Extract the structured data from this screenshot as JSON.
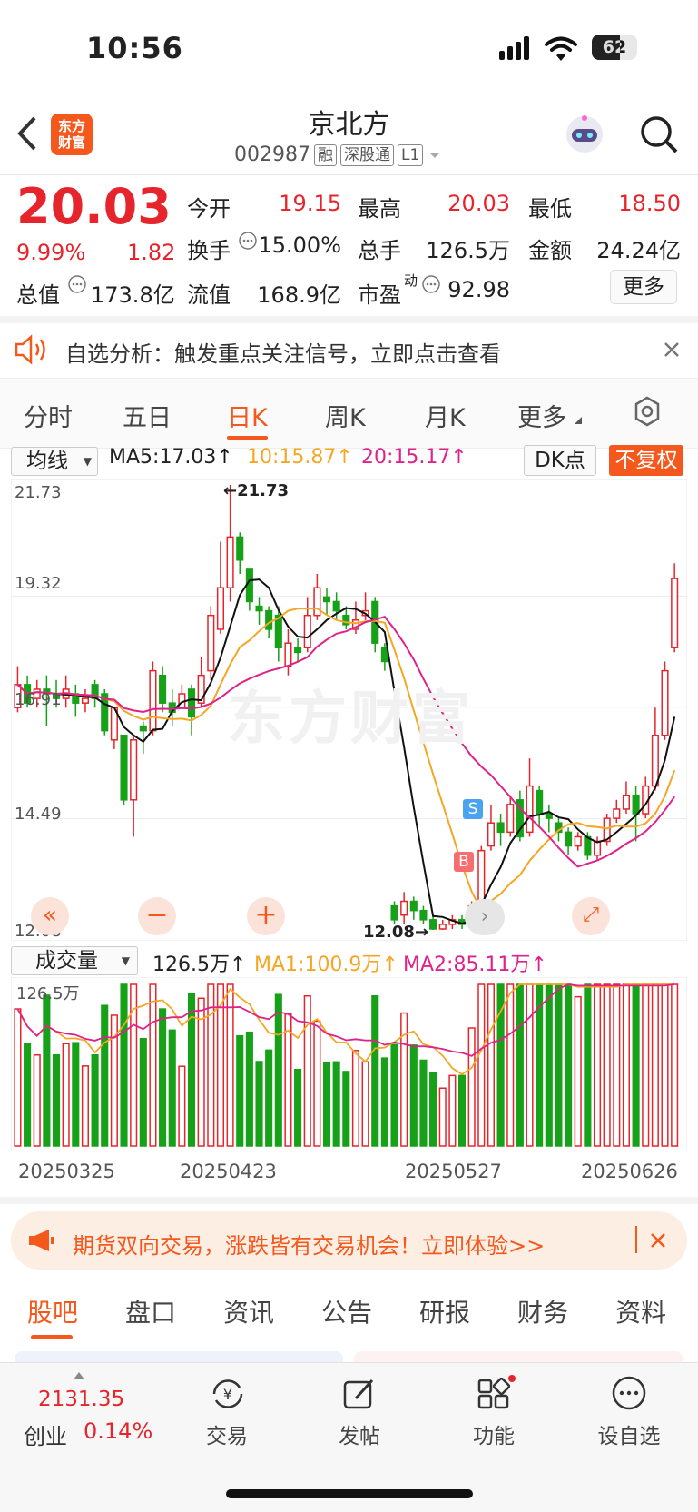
{
  "status": {
    "time": "10:56",
    "battery": "62"
  },
  "header": {
    "title": "京北方",
    "code": "002987",
    "tags": [
      "融",
      "深股通",
      "L1"
    ],
    "logo": "东方\n财富"
  },
  "quote": {
    "price": "20.03",
    "pct": "9.99%",
    "chg": "1.82",
    "fields": [
      {
        "label": "今开",
        "value": "19.15",
        "color": "red"
      },
      {
        "label": "最高",
        "value": "20.03",
        "color": "red"
      },
      {
        "label": "最低",
        "value": "18.50",
        "color": "red"
      },
      {
        "label": "换手",
        "value": "15.00%",
        "color": "dark"
      },
      {
        "label": "总手",
        "value": "126.5万",
        "color": "dark"
      },
      {
        "label": "金额",
        "value": "24.24亿",
        "color": "dark"
      },
      {
        "label": "总值",
        "value": "173.8亿",
        "color": "dark"
      },
      {
        "label": "流值",
        "value": "168.9亿",
        "color": "dark"
      },
      {
        "label": "市盈",
        "value": "92.98",
        "color": "dark",
        "sup": "动"
      }
    ],
    "more": "更多"
  },
  "alert": {
    "text": "自选分析：触发重点关注信号，立即点击查看"
  },
  "tabs": [
    "分时",
    "五日",
    "日K",
    "周K",
    "月K",
    "更多"
  ],
  "active_tab": "日K",
  "ma": {
    "selector": "均线",
    "ma5": "MA5:17.03",
    "ma10": "10:15.87",
    "ma20": "20:15.17",
    "dk": "DK点",
    "fq": "不复权"
  },
  "chart": {
    "y_ticks": [
      "21.73",
      "19.32",
      "16.91",
      "14.49",
      "12.08"
    ],
    "high_label": "21.73",
    "low_label": "12.08",
    "watermark": "东方财富",
    "b_mark": "B",
    "s_mark": "S"
  },
  "volume": {
    "selector": "成交量",
    "vol": "126.5万",
    "ma1": "MA1:100.9万",
    "ma2": "MA2:85.11万",
    "top_tick": "126.5万",
    "dates": [
      "20250325",
      "20250423",
      "20250527",
      "20250626"
    ]
  },
  "banner": {
    "text": "期货双向交易，涨跌皆有交易机会！立即体验>>"
  },
  "bottom_tabs": [
    "股吧",
    "盘口",
    "资讯",
    "公告",
    "研报",
    "财务",
    "资料"
  ],
  "bottom_bar": {
    "index_value": "2131.35",
    "index_name": "创业",
    "index_pct": "0.14%",
    "items": [
      "交易",
      "发帖",
      "功能",
      "设自选"
    ]
  },
  "colors": {
    "up": "#e5252b",
    "down": "#16a118",
    "accent": "#f4581c",
    "ma5": "#111111",
    "ma10": "#f5a623",
    "ma20": "#e0218a"
  },
  "chart_data": {
    "type": "candlestick",
    "ylim": [
      12.08,
      21.73
    ],
    "candles": [
      [
        16.9,
        17.4,
        17.8,
        16.8
      ],
      [
        17.4,
        17.0,
        17.6,
        16.9
      ],
      [
        17.1,
        17.3,
        17.5,
        16.9
      ],
      [
        17.3,
        17.2,
        17.6,
        16.5
      ],
      [
        17.2,
        17.1,
        17.5,
        16.9
      ],
      [
        17.1,
        17.3,
        17.6,
        16.9
      ],
      [
        17.2,
        17.0,
        17.4,
        16.7
      ],
      [
        17.0,
        17.1,
        17.3,
        16.8
      ],
      [
        17.4,
        17.1,
        17.5,
        16.9
      ],
      [
        17.2,
        16.4,
        17.3,
        16.3
      ],
      [
        16.2,
        16.9,
        16.9,
        16.0
      ],
      [
        16.3,
        14.9,
        16.3,
        14.8
      ],
      [
        14.9,
        16.2,
        16.3,
        14.1
      ],
      [
        16.5,
        16.4,
        16.6,
        15.9
      ],
      [
        16.4,
        17.7,
        17.9,
        16.3
      ],
      [
        17.6,
        17.0,
        17.8,
        16.8
      ],
      [
        17.0,
        16.8,
        17.3,
        16.5
      ],
      [
        16.9,
        17.2,
        17.4,
        16.9
      ],
      [
        17.3,
        16.7,
        17.4,
        16.3
      ],
      [
        17.0,
        17.6,
        18.0,
        16.9
      ],
      [
        17.7,
        18.9,
        19.1,
        17.5
      ],
      [
        18.6,
        19.5,
        20.5,
        18.5
      ],
      [
        19.5,
        20.6,
        21.73,
        19.2
      ],
      [
        20.6,
        20.1,
        20.7,
        19.8
      ],
      [
        19.9,
        19.2,
        19.9,
        19.0
      ],
      [
        19.1,
        19.0,
        19.3,
        18.7
      ],
      [
        19.0,
        18.6,
        19.1,
        18.4
      ],
      [
        18.9,
        18.2,
        19.1,
        17.9
      ],
      [
        17.8,
        18.3,
        18.6,
        17.6
      ],
      [
        18.2,
        18.1,
        18.4,
        17.9
      ],
      [
        18.2,
        18.9,
        19.3,
        18.1
      ],
      [
        18.9,
        19.5,
        19.8,
        18.8
      ],
      [
        19.3,
        19.2,
        19.5,
        18.9
      ],
      [
        19.2,
        19.0,
        19.4,
        18.8
      ],
      [
        18.9,
        18.7,
        19.1,
        18.6
      ],
      [
        18.6,
        18.8,
        19.2,
        18.5
      ],
      [
        18.9,
        19.0,
        19.4,
        18.8
      ],
      [
        19.2,
        18.3,
        19.3,
        18.1
      ],
      [
        18.2,
        17.9,
        18.3,
        17.7
      ],
      [
        12.6,
        12.3,
        12.7,
        12.2
      ],
      [
        12.4,
        12.7,
        12.9,
        12.2
      ],
      [
        12.7,
        12.5,
        12.8,
        12.3
      ],
      [
        12.5,
        12.3,
        12.6,
        12.2
      ],
      [
        12.3,
        12.1,
        12.4,
        12.08
      ],
      [
        12.1,
        12.2,
        12.3,
        12.08
      ],
      [
        12.2,
        12.3,
        12.4,
        12.1
      ],
      [
        12.3,
        12.2,
        12.4,
        12.1
      ],
      [
        12.2,
        12.6,
        12.7,
        12.1
      ],
      [
        12.6,
        13.8,
        13.9,
        12.5
      ],
      [
        13.9,
        14.4,
        14.8,
        13.8
      ],
      [
        14.4,
        14.2,
        14.6,
        13.9
      ],
      [
        14.2,
        14.8,
        15.0,
        14.1
      ],
      [
        14.9,
        14.1,
        15.1,
        14.0
      ],
      [
        14.2,
        15.2,
        15.8,
        14.1
      ],
      [
        15.1,
        14.6,
        15.2,
        14.3
      ],
      [
        14.6,
        14.5,
        14.8,
        14.2
      ],
      [
        14.4,
        14.2,
        14.5,
        14.0
      ],
      [
        14.2,
        13.9,
        14.3,
        13.7
      ],
      [
        13.9,
        14.1,
        14.2,
        13.8
      ],
      [
        14.1,
        13.7,
        14.2,
        13.6
      ],
      [
        13.7,
        14.0,
        14.1,
        13.6
      ],
      [
        14.0,
        14.5,
        14.6,
        13.9
      ],
      [
        14.5,
        14.7,
        14.9,
        14.4
      ],
      [
        14.7,
        15.0,
        15.3,
        14.6
      ],
      [
        15.0,
        14.6,
        15.2,
        14.0
      ],
      [
        14.6,
        15.2,
        15.4,
        14.5
      ],
      [
        15.2,
        16.3,
        16.9,
        15.1
      ],
      [
        16.3,
        17.7,
        17.9,
        16.2
      ],
      [
        18.2,
        19.7,
        20.03,
        18.1
      ]
    ]
  }
}
